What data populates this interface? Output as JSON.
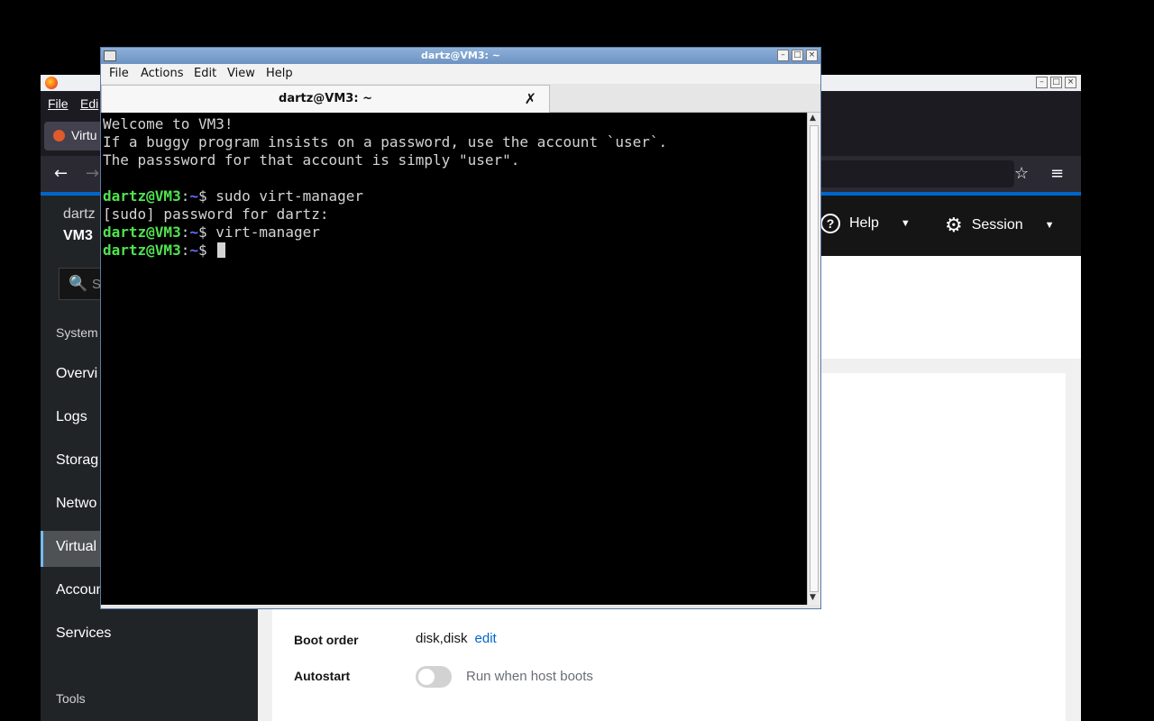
{
  "browser": {
    "menubar": {
      "file": "File",
      "edit": "Edi"
    },
    "tab": {
      "label": "Virtu"
    },
    "nav": {
      "back_icon": "back-arrow-icon",
      "forward_icon": "forward-arrow-icon",
      "bookmark_icon": "star-icon",
      "menu_icon": "hamburger-menu-icon"
    },
    "accent": "#0066cc"
  },
  "cockpit": {
    "host_user": "dartz",
    "host_name": "VM3",
    "search_placeholder": "S",
    "header": {
      "help": "Help",
      "session": "Session"
    },
    "sidebar": {
      "section_system": "System",
      "items": [
        {
          "label": "Overvi"
        },
        {
          "label": "Logs"
        },
        {
          "label": "Storag"
        },
        {
          "label": "Netwo"
        },
        {
          "label": "Virtual"
        },
        {
          "label": "Accoun"
        },
        {
          "label": "Services"
        }
      ],
      "section_tools": "Tools",
      "active_index": 4
    },
    "details": {
      "boot_order_label": "Boot order",
      "boot_order_value": "disk,disk",
      "boot_order_edit": "edit",
      "autostart_label": "Autostart",
      "autostart_toggle": "Run when host boots",
      "autostart_on": false
    }
  },
  "terminal": {
    "window_title": "dartz@VM3: ~",
    "menu": {
      "file": "File",
      "actions": "Actions",
      "edit": "Edit",
      "view": "View",
      "help": "Help"
    },
    "tab_title": "dartz@VM3: ~",
    "lines": {
      "l1": "Welcome to VM3!",
      "l2": "If a buggy program insists on a password, use the account `user`.",
      "l3": "The passsword for that account is simply \"user\".",
      "prompt_user": "dartz@VM3",
      "prompt_colon": ":",
      "prompt_path": "~",
      "prompt_symbol": "$ ",
      "cmd1": "sudo virt-manager",
      "sudo_prompt": "[sudo] password for dartz:",
      "cmd2": "virt-manager"
    }
  }
}
